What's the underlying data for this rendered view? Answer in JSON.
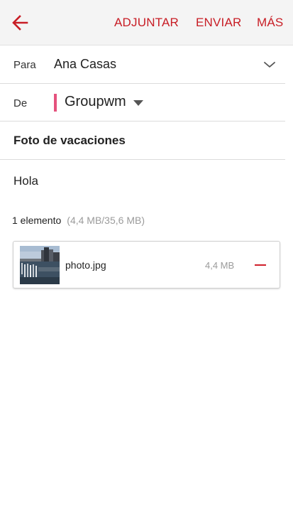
{
  "toolbar": {
    "back_icon": "arrow-left-icon",
    "attach_label": "ADJUNTAR",
    "send_label": "ENVIAR",
    "more_label": "MÁS",
    "accent_color": "#c81d25"
  },
  "compose": {
    "to_label": "Para",
    "to_value": "Ana Casas",
    "to_expand_icon": "chevron-down-icon",
    "from_label": "De",
    "from_value": "Groupwm",
    "from_account_color": "#e5527d",
    "from_dropdown_icon": "caret-down-icon",
    "subject": "Foto de vacaciones",
    "body": "Hola"
  },
  "attachments": {
    "count_text": "1 elemento",
    "size_text": "(4,4 MB/35,6 MB)",
    "items": [
      {
        "file_name": "photo.jpg",
        "file_size": "4,4 MB",
        "thumbnail_icon": "photo-thumbnail",
        "remove_icon": "minus-icon"
      }
    ]
  }
}
